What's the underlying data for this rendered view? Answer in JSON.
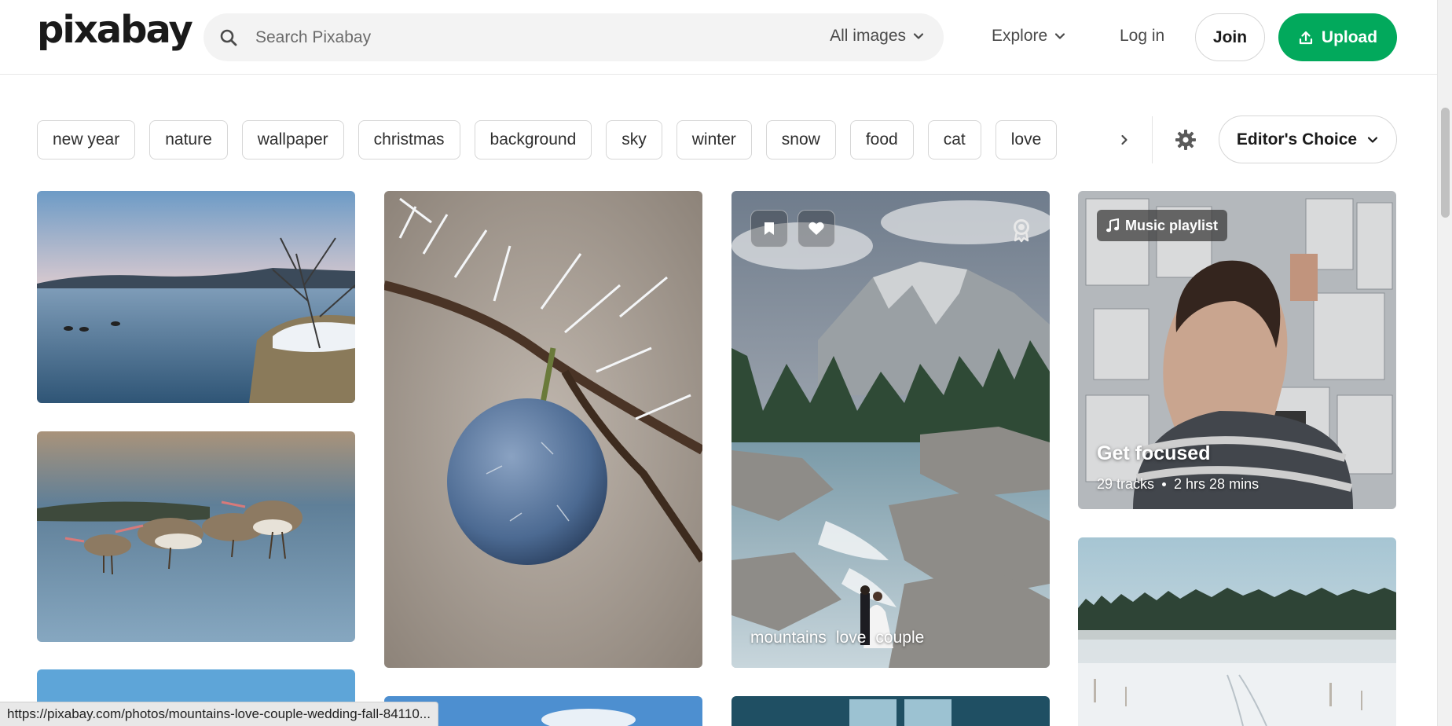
{
  "header": {
    "logo": "pixabay",
    "search_placeholder": "Search Pixabay",
    "search_scope": "All images",
    "explore_label": "Explore",
    "login_label": "Log in",
    "join_label": "Join",
    "upload_label": "Upload",
    "accent_color": "#02a95c"
  },
  "tags": [
    "new year",
    "nature",
    "wallpaper",
    "christmas",
    "background",
    "sky",
    "winter",
    "snow",
    "food",
    "cat",
    "love"
  ],
  "filter": {
    "editors_choice_label": "Editor's Choice"
  },
  "grid": {
    "featured_tags": [
      "mountains",
      "love",
      "couple"
    ],
    "playlist": {
      "badge": "Music playlist",
      "title": "Get focused",
      "tracks": "29 tracks",
      "duration": "2 hrs 28 mins"
    }
  },
  "statusbar": {
    "url": "https://pixabay.com/photos/mountains-love-couple-wedding-fall-84110..."
  }
}
